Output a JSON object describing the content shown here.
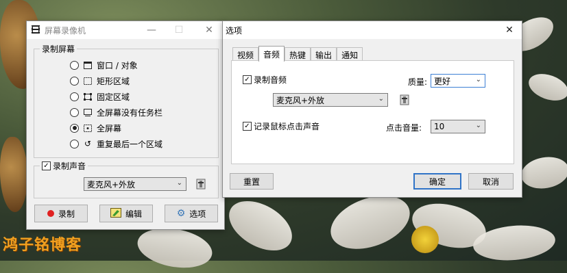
{
  "recorder": {
    "title": "屏幕录像机",
    "record_screen_group": "录制屏幕",
    "options": [
      {
        "label": "窗口 / 对象",
        "icon": "window-icon",
        "checked": false
      },
      {
        "label": "矩形区域",
        "icon": "rectangle-select-icon",
        "checked": false
      },
      {
        "label": "固定区域",
        "icon": "fixed-region-icon",
        "checked": false
      },
      {
        "label": "全屏幕没有任务栏",
        "icon": "screen-no-taskbar-icon",
        "checked": false
      },
      {
        "label": "全屏幕",
        "icon": "fullscreen-icon",
        "checked": true
      },
      {
        "label": "重复最后一个区域",
        "icon": "repeat-region-icon",
        "checked": false
      }
    ],
    "record_audio_label": "录制声音",
    "record_audio_checked": true,
    "audio_source": "麦克风+外放",
    "buttons": {
      "record": "录制",
      "edit": "编辑",
      "options": "选项"
    }
  },
  "options_dialog": {
    "title": "选项",
    "tabs": [
      "视频",
      "音频",
      "热键",
      "输出",
      "通知"
    ],
    "active_tab": "音频",
    "record_audio_label": "录制音频",
    "record_audio_checked": true,
    "quality_label": "质量:",
    "quality_value": "更好",
    "audio_source": "麦克风+外放",
    "record_click_label": "记录鼠标点击声音",
    "record_click_checked": true,
    "click_volume_label": "点击音量:",
    "click_volume_value": "10",
    "reset_button": "重置",
    "ok_button": "确定",
    "cancel_button": "取消"
  },
  "watermark": "鸿子铭博客",
  "colors": {
    "accent": "#2f73c7",
    "record_dot": "#e02020",
    "watermark": "#f0a020"
  }
}
